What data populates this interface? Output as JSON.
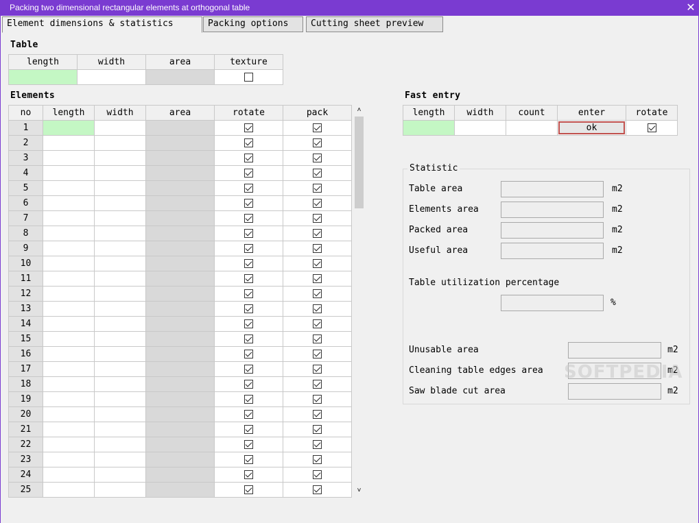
{
  "window": {
    "title": "Packing two dimensional rectangular elements at orthogonal table",
    "close_glyph": "✕"
  },
  "tabs": [
    {
      "label": "Element dimensions & statistics"
    },
    {
      "label": "Packing options"
    },
    {
      "label": "Cutting sheet preview"
    }
  ],
  "table_section": {
    "title": "Table",
    "headers": [
      "length",
      "width",
      "area",
      "texture"
    ],
    "texture_checked": false
  },
  "elements_section": {
    "title": "Elements",
    "headers": [
      "no",
      "length",
      "width",
      "area",
      "rotate",
      "pack"
    ],
    "row_numbers": [
      "1",
      "2",
      "3",
      "4",
      "5",
      "6",
      "7",
      "8",
      "9",
      "10",
      "11",
      "12",
      "13",
      "14",
      "15",
      "16",
      "17",
      "18",
      "19",
      "20",
      "21",
      "22",
      "23",
      "24",
      "25"
    ],
    "rotate_checked": true,
    "pack_checked": true
  },
  "fast_entry": {
    "title": "Fast entry",
    "headers": [
      "length",
      "width",
      "count",
      "enter",
      "rotate"
    ],
    "ok_label": "ok",
    "rotate_checked": true
  },
  "statistic": {
    "title": "Statistic",
    "table_area_label": "Table area",
    "elements_area_label": "Elements area",
    "packed_area_label": "Packed area",
    "useful_area_label": "Useful area",
    "utilization_label": "Table utilization percentage",
    "unusable_area_label": "Unusable area",
    "cleaning_edges_label": "Cleaning table edges area",
    "saw_blade_label": "Saw blade cut area",
    "unit_m2": "m2",
    "unit_percent": "%"
  },
  "watermark": "SOFTPEDIA",
  "colors": {
    "titlebar": "#7a3bd1",
    "entry_green": "#c4f7c4",
    "readonly_gray": "#d9d9d9",
    "ok_border": "#c0504d"
  }
}
